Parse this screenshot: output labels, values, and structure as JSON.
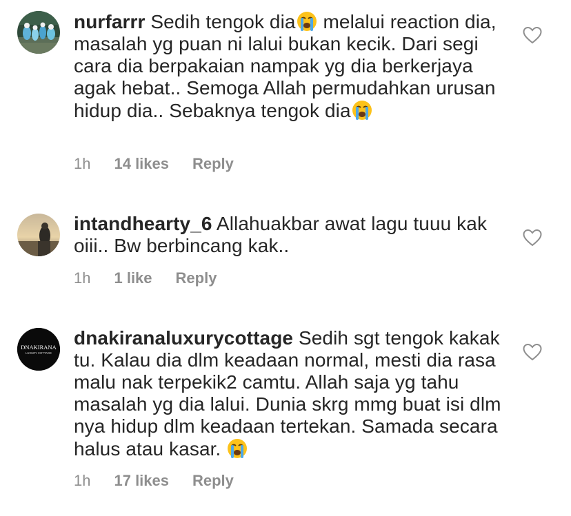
{
  "comments": [
    {
      "username": "nurfarrr",
      "segments": [
        " Sedih tengok dia",
        " melalui reaction dia, masalah yg puan ni lalui bukan kecik. Dari segi cara dia berpakaian nampak yg dia berkerjaya agak hebat.. Semoga Allah permudahkan urusan hidup dia.. Sebaknya tengok dia"
      ],
      "emoji": "loudly-crying-face",
      "time": "1h",
      "likes": "14 likes",
      "reply": "Reply"
    },
    {
      "username": "intandhearty_6",
      "text": " Allahuakbar awat lagu tuuu kak oiii.. Bw berbincang kak..",
      "time": "1h",
      "likes": "1 like",
      "reply": "Reply"
    },
    {
      "username": "dnakiranaluxurycottage",
      "text": " Sedih sgt tengok kakak tu. Kalau dia dlm keadaan normal, mesti dia rasa malu nak terpekik2 camtu. Allah saja yg tahu masalah yg dia lalui. Dunia skrg mmg buat isi dlm nya hidup dlm keadaan tertekan. Samada secara halus atau kasar. ",
      "emoji": "loudly-crying-face",
      "avatar_logo": "DNAKIRANA",
      "avatar_sub": "LUXURY COTTAGE",
      "time": "1h",
      "likes": "17 likes",
      "reply": "Reply"
    }
  ],
  "icons": {
    "like": "heart-outline-icon"
  },
  "colors": {
    "text": "#262626",
    "meta": "#8e8e8e",
    "background": "#ffffff"
  }
}
